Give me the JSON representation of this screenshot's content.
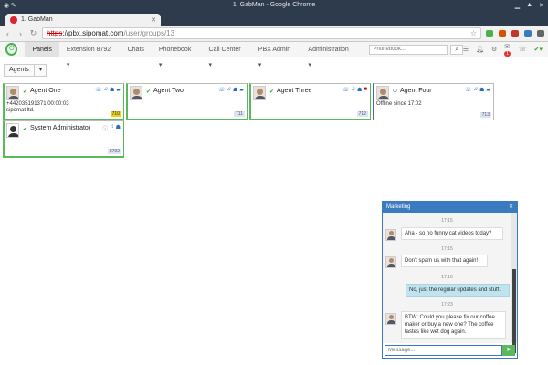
{
  "window": {
    "title": "1. GabMan - Google Chrome"
  },
  "tab": {
    "title": "1. GabMan"
  },
  "address": {
    "scheme": "https",
    "host": "://pbx.sipomat.com",
    "path": "/user/groups/13"
  },
  "nav": {
    "items": [
      "Panels",
      "Extension 8792 ▾",
      "Chats",
      "Phonebook ▾",
      "Call Center ▾",
      "PBX Admin ▾",
      "Administration ▾"
    ],
    "search_placeholder": "Phonebook...",
    "messages_badge": "1"
  },
  "group_select": {
    "label": "Agents"
  },
  "agents": [
    {
      "name": "Agent One",
      "line1": "+442035191371 00:00:03",
      "line2": "sipomat ltd.",
      "ext": "710",
      "status": "online"
    },
    {
      "name": "Agent Two",
      "line1": "",
      "line2": "",
      "ext": "711",
      "status": "online"
    },
    {
      "name": "Agent Three",
      "line1": "",
      "line2": "",
      "ext": "712",
      "status": "online"
    },
    {
      "name": "Agent Four",
      "line1": "Offline since 17:02",
      "line2": "",
      "ext": "713",
      "status": "offline"
    },
    {
      "name": "System Administrator",
      "line1": "",
      "line2": "",
      "ext": "8792",
      "status": "online"
    }
  ],
  "chat": {
    "title": "Marketing",
    "messages": [
      {
        "time": "17:15",
        "text": "Aha - so no funny cat videos today?",
        "own": false
      },
      {
        "time": "17:15",
        "text": "Don't spam us with that again!",
        "own": false
      },
      {
        "time": "17:16",
        "text": "No, just the regular updates and stuff.",
        "own": true
      },
      {
        "time": "17:23",
        "text": "BTW: Could you please fix our coffee maker or buy a new one? The coffee tastes like wet dog again.",
        "own": false
      }
    ],
    "input_placeholder": "Message..."
  }
}
